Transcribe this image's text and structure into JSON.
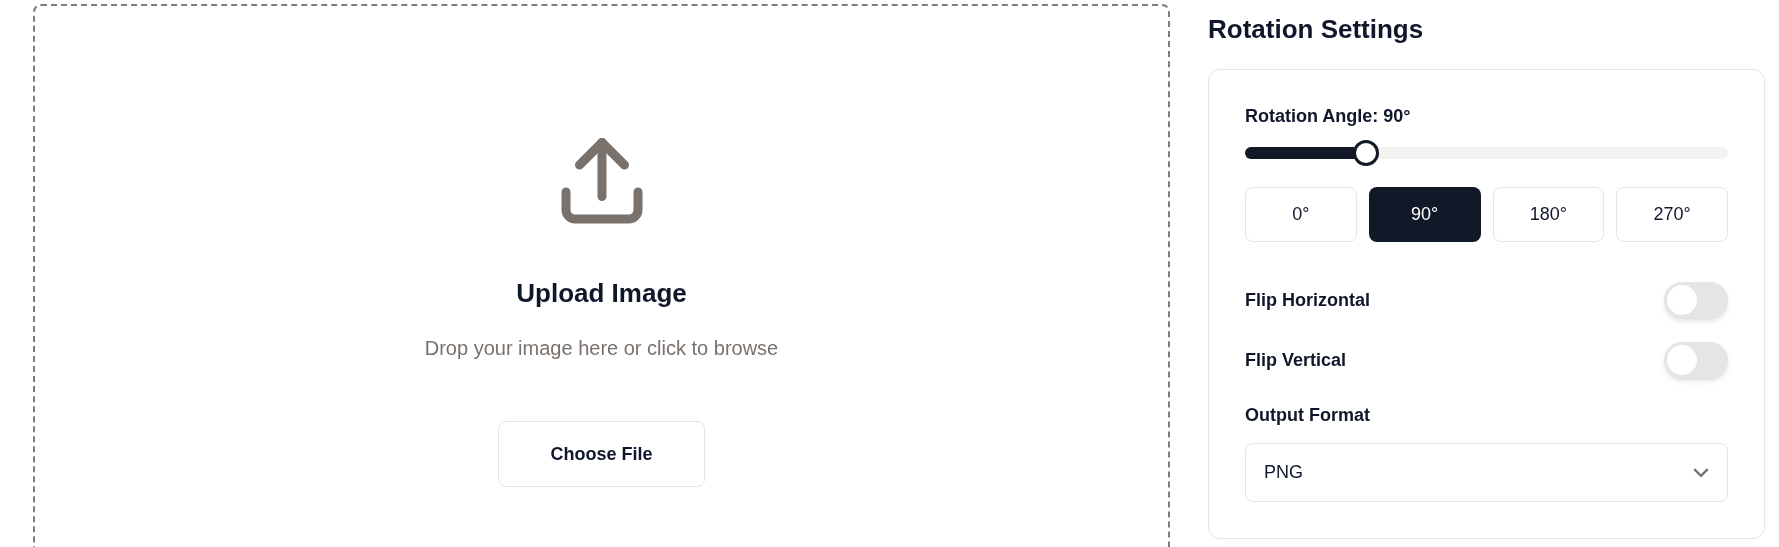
{
  "upload": {
    "title": "Upload Image",
    "subtitle": "Drop your image here or click to browse",
    "button": "Choose File"
  },
  "settings": {
    "title": "Rotation Settings",
    "angle": {
      "label": "Rotation Angle: 90°",
      "level": 0.25
    },
    "presets": [
      {
        "label": "0°",
        "selected": false
      },
      {
        "label": "90°",
        "selected": true
      },
      {
        "label": "180°",
        "selected": false
      },
      {
        "label": "270°",
        "selected": false
      }
    ],
    "toggles": [
      {
        "label": "Flip Horizontal",
        "on": false
      },
      {
        "label": "Flip Vertical",
        "on": false
      }
    ],
    "output_format": {
      "label": "Output Format",
      "value": "PNG"
    }
  }
}
